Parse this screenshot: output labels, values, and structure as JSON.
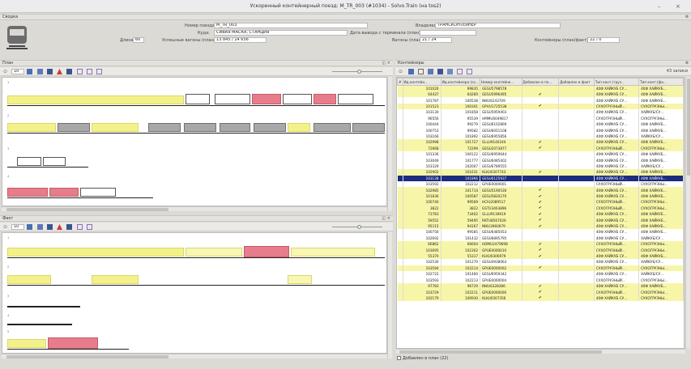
{
  "window": {
    "title": "Ускоренный контейнерный поезд: М_TR_003 (#1034) - Solvo.Train (на tos2)",
    "min_label": "–",
    "close_label": "×"
  },
  "header_section": {
    "title": "Сводка",
    "train_number_label": "Номер поезда:",
    "train_number_value": "M_TR_003",
    "where_label": "Куда:",
    "where_value": "СИВАЯ МАСКА, СТАНЦИЯ",
    "length_label": "Длина:",
    "length_value": "60",
    "loaded_wagons_label": "Успешные вагоны (план/факт):",
    "loaded_wagons_value": "13 845 / 14 656",
    "owner_label": "Владелец:",
    "owner_value": "ТРАНСКОНТЕЙНЕР",
    "exit_date_label": "Дата вывода с терминала (план):",
    "exit_date_value": "",
    "wagons_label": "Вагоны (план/факт):",
    "wagons_value": "21 / 24",
    "containers_label": "Контейнеры (план/факт):",
    "containers_value": "22 / 0"
  },
  "plan_panel": {
    "title": "План",
    "zoom_value": "10",
    "lanes": [
      {
        "label": "1"
      },
      {
        "label": "2"
      },
      {
        "label": "3"
      },
      {
        "label": "4"
      }
    ]
  },
  "fact_panel": {
    "title": "Факт",
    "zoom_value": "10",
    "lanes": [
      {
        "label": "1"
      },
      {
        "label": "2"
      },
      {
        "label": "3"
      },
      {
        "label": "4"
      },
      {
        "label": "5"
      }
    ]
  },
  "containers_panel": {
    "title": "Контейнеры",
    "records_count": "43 записи",
    "columns": [
      "#",
      "Ид.контейн…",
      "Ид.контейнера (со…",
      "Номер контейне…",
      "Добавлен в по…",
      "Добавлен в факт",
      "Тип конт.(груз…",
      "Тип конт.(фа…"
    ],
    "rows": [
      {
        "id": "101026",
        "id2": "99835",
        "number": "GESU5798578",
        "inplan": "",
        "infact": "",
        "type1": "40Ф ХАЙКУБ СУ…",
        "type2": "40Ф ХАЙКУБ…",
        "color": "y"
      },
      {
        "id": "64437",
        "id2": "64260",
        "number": "GESU5996495",
        "inplan": "✔",
        "infact": "",
        "type1": "40Ф ХАЙКУБ СУ…",
        "type2": "40Ф ХАЙКУБ…",
        "color": "y"
      },
      {
        "id": "101787",
        "id2": "100538",
        "number": "INKU6243709",
        "inplan": "",
        "infact": "",
        "type1": "40Ф ХАЙКУБ СУ…",
        "type2": "40Ф ХАЙКУБ…",
        "color": "w"
      },
      {
        "id": "101523",
        "id2": "100301",
        "number": "GPVU1725538",
        "inplan": "✔",
        "infact": "",
        "type1": "СУХОГРУЗНЫЙ…",
        "type2": "СУХОГРУЗНЫ…",
        "color": "y"
      },
      {
        "id": "103130",
        "id2": "101858",
        "number": "GESU5959403",
        "inplan": "",
        "infact": "",
        "type1": "40Ф ХАЙКУБ СУ…",
        "type2": "ХАЙКУБ/СУ…",
        "color": "w"
      },
      {
        "id": "96556",
        "id2": "95539",
        "number": "HMMU6049817",
        "inplan": "",
        "infact": "",
        "type1": "СУХОГРУЗНЫЙ…",
        "type2": "СУХОГРУЗНЫ…",
        "color": "w"
      },
      {
        "id": "100444",
        "id2": "99279",
        "number": "GESU6102869",
        "inplan": "",
        "infact": "",
        "type1": "40Ф ХАЙКУБ СУ…",
        "type2": "40Ф ХАЙКУБ…",
        "color": "w"
      },
      {
        "id": "100753",
        "id2": "99582",
        "number": "GESU6051108",
        "inplan": "",
        "infact": "",
        "type1": "40Ф ХАЙКУБ СУ…",
        "type2": "40Ф ХАЙКУБ…",
        "color": "w"
      },
      {
        "id": "103166",
        "id2": "101892",
        "number": "GESU6955856",
        "inplan": "",
        "infact": "",
        "type1": "40Ф ХАЙКУБ СУ…",
        "type2": "ХАЙКУБ/СУ…",
        "color": "w"
      },
      {
        "id": "102998",
        "id2": "101727",
        "number": "GLLU9140244",
        "inplan": "✔",
        "infact": "",
        "type1": "40Ф ХАЙКУБ СУ…",
        "type2": "40Ф ХАЙКУБ…",
        "color": "y"
      },
      {
        "id": "72668",
        "id2": "72299",
        "number": "GESU2073877",
        "inplan": "✔",
        "infact": "",
        "type1": "СУХОГРУЗНЫЙ…",
        "type2": "СУХОГРУЗНЫ…",
        "color": "y"
      },
      {
        "id": "101336",
        "id2": "100122",
        "number": "GESU6959644",
        "inplan": "",
        "infact": "",
        "type1": "40Ф ХАЙКУБ СУ…",
        "type2": "40Ф ХАЙКУБ…",
        "color": "w"
      },
      {
        "id": "103049",
        "id2": "101777",
        "number": "GESU6485402",
        "inplan": "",
        "infact": "",
        "type1": "40Ф ХАЙКУБ СУ…",
        "type2": "40Ф ХАЙКУБ…",
        "color": "w"
      },
      {
        "id": "103329",
        "id2": "102007",
        "number": "GESU6789555",
        "inplan": "",
        "infact": "",
        "type1": "40Ф ХАЙКУБ СУ…",
        "type2": "ХАЙКУБ/СУ…",
        "color": "w"
      },
      {
        "id": "102902",
        "id2": "101631",
        "number": "KLKU0307743",
        "inplan": "✔",
        "infact": "",
        "type1": "40Ф ХАЙКУБ СУ…",
        "type2": "40Ф ХАЙКУБ…",
        "color": "y"
      },
      {
        "id": "103138",
        "id2": "101866",
        "number": "GESU6125937",
        "inplan": "",
        "infact": "",
        "type1": "40Ф ХАЙКУБ СУ…",
        "type2": "40Ф ХАЙКУБ…",
        "color": "sel"
      },
      {
        "id": "103592",
        "id2": "102212",
        "number": "GPUE0000001",
        "inplan": "",
        "infact": "",
        "type1": "СУХОГРУЗНЫЙ…",
        "type2": "СУХОГРУЗНЫ…",
        "color": "w"
      },
      {
        "id": "102985",
        "id2": "101714",
        "number": "GESU5190530",
        "inplan": "✔",
        "infact": "",
        "type1": "40Ф ХАЙКУБ СУ…",
        "type2": "40Ф ХАЙКУБ…",
        "color": "y"
      },
      {
        "id": "101836",
        "id2": "100587",
        "number": "GESU5820270",
        "inplan": "✔",
        "infact": "",
        "type1": "40Ф ХАЙКУБ СУ…",
        "type2": "40Ф ХАЙКУБ…",
        "color": "y"
      },
      {
        "id": "100740",
        "id2": "99569",
        "number": "HCIU2089517",
        "inplan": "✔",
        "infact": "",
        "type1": "СУХОГРУЗНЫЙ…",
        "type2": "СУХОГРУЗНЫ…",
        "color": "y"
      },
      {
        "id": "3822",
        "id2": "3822",
        "number": "GSTU3403896",
        "inplan": "✔",
        "infact": "",
        "type1": "СУХОГРУЗНЫЙ…",
        "type2": "СУХОГРУЗНЫ…",
        "color": "y"
      },
      {
        "id": "73783",
        "id2": "73402",
        "number": "GLLU9139619",
        "inplan": "✔",
        "infact": "",
        "type1": "40Ф ХАЙКУБ СУ…",
        "type2": "40Ф ХАЙКУБ…",
        "color": "y"
      },
      {
        "id": "59552",
        "id2": "59495",
        "number": "RKTU8567026",
        "inplan": "✔",
        "infact": "",
        "type1": "40Ф ХАЙКУБ СУ…",
        "type2": "40Ф ХАЙКУБ…",
        "color": "y"
      },
      {
        "id": "95115",
        "id2": "94167",
        "number": "INKU3960679",
        "inplan": "✔",
        "infact": "",
        "type1": "40Ф ХАЙКУБ СУ…",
        "type2": "40Ф ХАЙКУБ…",
        "color": "y"
      },
      {
        "id": "100756",
        "id2": "99585",
        "number": "GESU6485053",
        "inplan": "",
        "infact": "",
        "type1": "40Ф ХАЙКУБ СУ…",
        "type2": "40Ф ХАЙКУБ…",
        "color": "w"
      },
      {
        "id": "102692",
        "id2": "101432",
        "number": "GESU6895795",
        "inplan": "",
        "infact": "",
        "type1": "40Ф ХАЙКУБ СУ…",
        "type2": "ХАЙКУБ/СУ…",
        "color": "w"
      },
      {
        "id": "66862",
        "id2": "66604",
        "number": "HDMU2479698",
        "inplan": "✔",
        "infact": "",
        "type1": "СУХОГРУЗНЫЙ…",
        "type2": "СУХОГРУЗНЫ…",
        "color": "y"
      },
      {
        "id": "103695",
        "id2": "102302",
        "number": "GPUE0000010",
        "inplan": "✔",
        "infact": "",
        "type1": "СУХОГРУЗНЫЙ…",
        "type2": "СУХОГРУЗНЫ…",
        "color": "y"
      },
      {
        "id": "55370",
        "id2": "55317",
        "number": "KLKU0306979",
        "inplan": "✔",
        "infact": "",
        "type1": "40Ф ХАЙКУБ СУ…",
        "type2": "40Ф ХАЙКУБ…",
        "color": "y"
      },
      {
        "id": "102530",
        "id2": "101270",
        "number": "GESU4938063",
        "inplan": "",
        "infact": "",
        "type1": "40Ф ХАЙКУБ СУ…",
        "type2": "ХАЙКУБ/СУ…",
        "color": "w"
      },
      {
        "id": "103594",
        "id2": "102214",
        "number": "GPUE0000002",
        "inplan": "✔",
        "infact": "",
        "type1": "СУХОГРУЗНЫЙ…",
        "type2": "СУХОГРУЗНЫ…",
        "color": "y"
      },
      {
        "id": "102722",
        "id2": "101460",
        "number": "GESU6959342",
        "inplan": "",
        "infact": "",
        "type1": "40Ф ХАЙКУБ СУ…",
        "type2": "ХАЙКУБ/СУ…",
        "color": "w"
      },
      {
        "id": "103593",
        "id2": "102213",
        "number": "GPUE0000004",
        "inplan": "",
        "infact": "",
        "type1": "СУХОГРУЗНЫЙ…",
        "type2": "СУХОГРУЗНЫ…",
        "color": "w"
      },
      {
        "id": "97783",
        "id2": "96729",
        "number": "INKU6328386",
        "inplan": "✔",
        "infact": "",
        "type1": "40Ф ХАЙКУБ СУ…",
        "type2": "40Ф ХАЙКУБ…",
        "color": "y"
      },
      {
        "id": "103729",
        "id2": "102211",
        "number": "GPUE0000000",
        "inplan": "✔",
        "infact": "",
        "type1": "СУХОГРУЗНЫЙ…",
        "type2": "СУХОГРУЗНЫ…",
        "color": "y"
      },
      {
        "id": "102179",
        "id2": "100930",
        "number": "KLKU0307356",
        "inplan": "✔",
        "infact": "",
        "type1": "40Ф ХАЙКУБ СУ…",
        "type2": "СУХОГРУЗНЫ…",
        "color": "y"
      }
    ],
    "footer_label": "Добавлен в план (22)"
  },
  "colors": {
    "plan_yellow": "#f3f28a",
    "red_wagon": "#e77d8b",
    "selection": "#1c2d7d"
  }
}
